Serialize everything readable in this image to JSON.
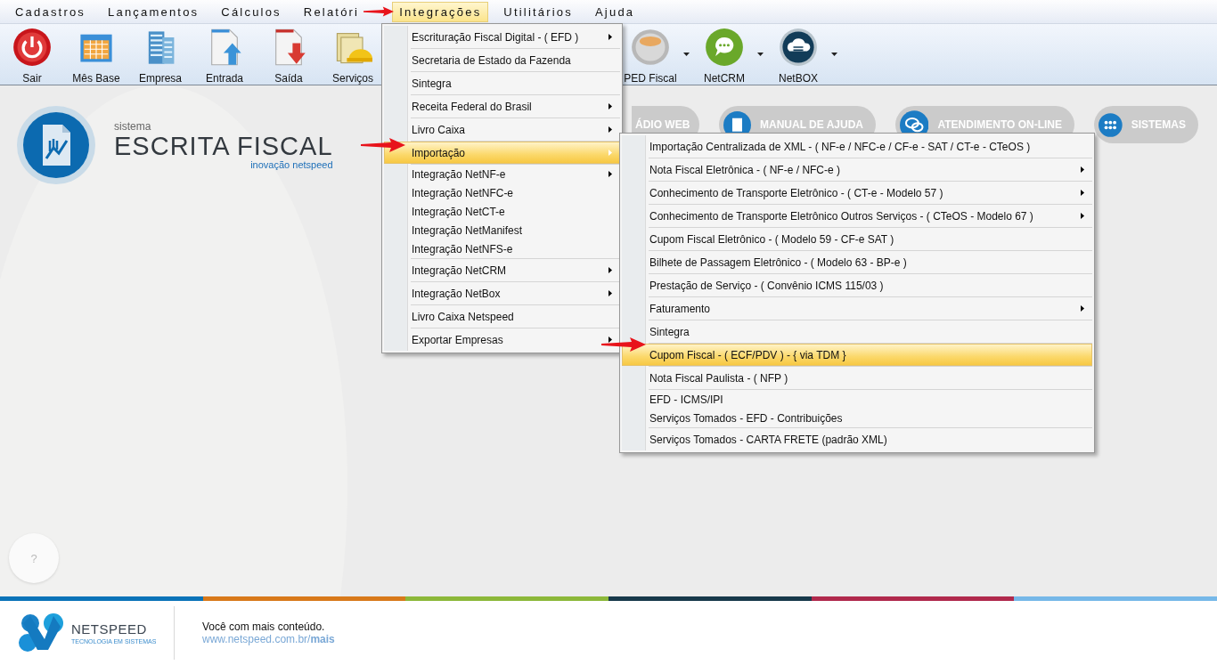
{
  "menu_bar": [
    {
      "label": "Cadastros",
      "selected": false
    },
    {
      "label": "Lançamentos",
      "selected": false
    },
    {
      "label": "Cálculos",
      "selected": false
    },
    {
      "label": "Relatóri",
      "selected": false
    },
    {
      "label": "Integrações",
      "selected": true
    },
    {
      "label": "Utilitários",
      "selected": false
    },
    {
      "label": "Ajuda",
      "selected": false
    }
  ],
  "toolbar": [
    {
      "label": "Sair",
      "kind": "power",
      "dropdown": false
    },
    {
      "label": "Mês Base",
      "kind": "calendar",
      "dropdown": false
    },
    {
      "label": "Empresa",
      "kind": "building",
      "dropdown": false
    },
    {
      "label": "Entrada",
      "kind": "entry",
      "dropdown": false
    },
    {
      "label": "Saída",
      "kind": "exit",
      "dropdown": false
    },
    {
      "label": "Serviços",
      "kind": "services",
      "dropdown": false
    },
    {
      "label": "PED Fiscal",
      "kind": "sped",
      "dropdown": true
    },
    {
      "label": "NetCRM",
      "kind": "chat",
      "dropdown": true
    },
    {
      "label": "NetBOX",
      "kind": "cloud",
      "dropdown": true
    }
  ],
  "logo": {
    "caption": "sistema",
    "title": "ESCRITA FISCAL",
    "tagline": "inovação netspeed"
  },
  "header_buttons": [
    {
      "label": "ÁDIO WEB",
      "kind": "cut"
    },
    {
      "label": "MANUAL DE AJUDA",
      "kind": "book"
    },
    {
      "label": "ATENDIMENTO ON-LINE",
      "kind": "chat"
    },
    {
      "label": "SISTEMAS",
      "kind": "grid"
    }
  ],
  "help_button": {
    "label": "?"
  },
  "integrations_menu": {
    "sections": [
      [
        {
          "label": "Escrituração Fiscal Digital - ( EFD )",
          "submenu": true,
          "selected": false
        }
      ],
      [
        {
          "label": "Secretaria de Estado da Fazenda",
          "submenu": false,
          "selected": false
        }
      ],
      [
        {
          "label": "Sintegra",
          "submenu": false,
          "selected": false
        }
      ],
      [
        {
          "label": "Receita Federal do Brasil",
          "submenu": true,
          "selected": false
        }
      ],
      [
        {
          "label": "Livro Caixa",
          "submenu": true,
          "selected": false
        }
      ],
      [
        {
          "label": "Importação",
          "submenu": true,
          "selected": true
        }
      ],
      [
        {
          "label": "Integração NetNF-e",
          "submenu": true,
          "selected": false
        },
        {
          "label": "Integração NetNFC-e",
          "submenu": false,
          "selected": false
        },
        {
          "label": "Integração NetCT-e",
          "submenu": false,
          "selected": false
        },
        {
          "label": "Integração NetManifest",
          "submenu": false,
          "selected": false
        },
        {
          "label": "Integração NetNFS-e",
          "submenu": false,
          "selected": false
        }
      ],
      [
        {
          "label": "Integração NetCRM",
          "submenu": true,
          "selected": false
        }
      ],
      [
        {
          "label": "Integração NetBox",
          "submenu": true,
          "selected": false
        }
      ],
      [
        {
          "label": "Livro Caixa Netspeed",
          "submenu": false,
          "selected": false
        }
      ],
      [
        {
          "label": "Exportar Empresas",
          "submenu": true,
          "selected": false
        }
      ]
    ]
  },
  "import_submenu": {
    "sections": [
      [
        {
          "label": "Importação Centralizada de XML - ( NF-e / NFC-e / CF-e - SAT / CT-e - CTeOS )",
          "submenu": false,
          "selected": false
        }
      ],
      [
        {
          "label": "Nota Fiscal Eletrônica - ( NF-e / NFC-e )",
          "submenu": true,
          "selected": false
        }
      ],
      [
        {
          "label": "Conhecimento de Transporte Eletrônico - ( CT-e - Modelo 57 )",
          "submenu": true,
          "selected": false
        }
      ],
      [
        {
          "label": "Conhecimento de Transporte Eletrônico Outros Serviços - ( CTeOS - Modelo 67 )",
          "submenu": true,
          "selected": false
        }
      ],
      [
        {
          "label": "Cupom Fiscal Eletrônico - ( Modelo 59 - CF-e SAT )",
          "submenu": false,
          "selected": false
        }
      ],
      [
        {
          "label": "Bilhete de Passagem Eletrônico - ( Modelo 63 - BP-e )",
          "submenu": false,
          "selected": false
        }
      ],
      [
        {
          "label": "Prestação de Serviço - ( Convênio ICMS 115/03 )",
          "submenu": false,
          "selected": false
        }
      ],
      [
        {
          "label": "Faturamento",
          "submenu": true,
          "selected": false
        }
      ],
      [
        {
          "label": "Sintegra",
          "submenu": false,
          "selected": false
        }
      ],
      [
        {
          "label": "Cupom Fiscal - ( ECF/PDV ) - { via TDM }",
          "submenu": false,
          "selected": true
        }
      ],
      [
        {
          "label": "Nota Fiscal Paulista - ( NFP )",
          "submenu": false,
          "selected": false
        }
      ],
      [
        {
          "label": "EFD - ICMS/IPI",
          "submenu": false,
          "selected": false
        },
        {
          "label": "Serviços Tomados - EFD - Contribuições",
          "submenu": false,
          "selected": false
        }
      ],
      [
        {
          "label": "Serviços Tomados - CARTA FRETE (padrão XML)",
          "submenu": false,
          "selected": false
        }
      ]
    ]
  },
  "footer": {
    "brand": "NETSPEED",
    "brand_tagline": "TECNOLOGIA EM SISTEMAS",
    "slogan": "Você com mais conteúdo.",
    "link": "www.netspeed.com.br/**mais**"
  }
}
